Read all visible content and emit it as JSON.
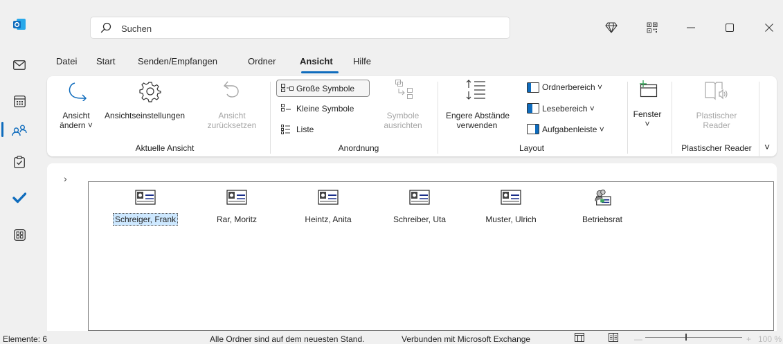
{
  "titlebar": {
    "search_placeholder": "Suchen"
  },
  "rail": {
    "items": [
      "outlook-logo",
      "mail-icon",
      "calendar-icon",
      "people-icon",
      "tasks-icon",
      "todo-icon",
      "apps-icon"
    ]
  },
  "menu": {
    "tabs": [
      "Datei",
      "Start",
      "Senden/Empfangen",
      "Ordner",
      "Ansicht",
      "Hilfe"
    ],
    "active": "Ansicht"
  },
  "ribbon": {
    "aktuelle_ansicht": {
      "group_label": "Aktuelle Ansicht",
      "view_change_1": "Ansicht",
      "view_change_2": "ändern ˅",
      "view_settings": "Ansichtseinstellungen",
      "reset_1": "Ansicht",
      "reset_2": "zurücksetzen"
    },
    "anordnung": {
      "group_label": "Anordnung",
      "large_icons": "Große Symbole",
      "small_icons": "Kleine Symbole",
      "list": "Liste",
      "align_1": "Symbole",
      "align_2": "ausrichten"
    },
    "layout": {
      "group_label": "Layout",
      "spacing_1": "Engere Abstände",
      "spacing_2": "verwenden",
      "folder_pane": "Ordnerbereich ˅",
      "reading_pane": "Lesebereich ˅",
      "todo_bar": "Aufgabenleiste ˅"
    },
    "fenster": {
      "label": "Fenster",
      "chevron": "˅"
    },
    "reader": {
      "group_label": "Plastischer Reader",
      "btn_1": "Plastischer",
      "btn_2": "Reader"
    },
    "collapse": "˅"
  },
  "contacts": [
    {
      "name": "Schreiger, Frank",
      "selected": true,
      "type": "contact"
    },
    {
      "name": "Rar, Moritz",
      "selected": false,
      "type": "contact"
    },
    {
      "name": "Heintz, Anita",
      "selected": false,
      "type": "contact"
    },
    {
      "name": "Schreiber, Uta",
      "selected": false,
      "type": "contact"
    },
    {
      "name": "Muster, Ulrich",
      "selected": false,
      "type": "contact"
    },
    {
      "name": "Betriebsrat",
      "selected": false,
      "type": "group"
    }
  ],
  "status": {
    "count": "Elemente: 6",
    "sync": "Alle Ordner sind auf dem neuesten Stand.",
    "connection": "Verbunden mit Microsoft Exchange",
    "zoom_minus": "—",
    "zoom_plus": "+",
    "zoom": "100 %"
  },
  "colors": {
    "accent": "#0f6cbd",
    "selection": "#cde8ff"
  }
}
